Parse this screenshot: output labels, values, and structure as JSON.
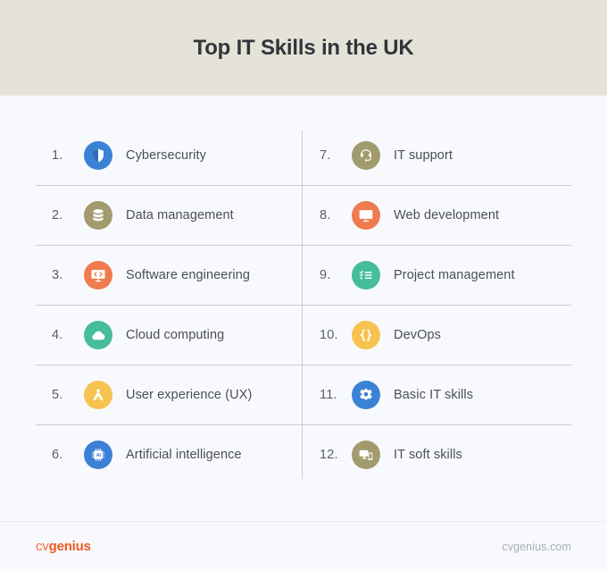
{
  "header": {
    "title": "Top IT Skills in the UK",
    "background_color": "#e5e2d8",
    "title_color": "#31343a"
  },
  "page": {
    "background_color": "#f8f9fc",
    "divider_color": "#c9cbd4",
    "label_color": "#4a4f58"
  },
  "skills": {
    "left_column": [
      {
        "rank": "1.",
        "label": "Cybersecurity",
        "icon": "shield-icon",
        "color": "#3b82d6"
      },
      {
        "rank": "2.",
        "label": "Data management",
        "icon": "database-icon",
        "color": "#a19b6e"
      },
      {
        "rank": "3.",
        "label": "Software engineering",
        "icon": "code-monitor-icon",
        "color": "#ef7b4e"
      },
      {
        "rank": "4.",
        "label": "Cloud computing",
        "icon": "cloud-icon",
        "color": "#45bd9a"
      },
      {
        "rank": "5.",
        "label": "User experience (UX)",
        "icon": "compass-icon",
        "color": "#f7c350"
      },
      {
        "rank": "6.",
        "label": "Artificial intelligence",
        "icon": "ai-chip-icon",
        "color": "#3b82d6"
      }
    ],
    "right_column": [
      {
        "rank": "7.",
        "label": "IT support",
        "icon": "headset-icon",
        "color": "#a19b6e"
      },
      {
        "rank": "8.",
        "label": "Web development",
        "icon": "monitor-icon",
        "color": "#ef7b4e"
      },
      {
        "rank": "9.",
        "label": "Project management",
        "icon": "checklist-icon",
        "color": "#45bd9a"
      },
      {
        "rank": "10.",
        "label": "DevOps",
        "icon": "braces-icon",
        "color": "#f7c350"
      },
      {
        "rank": "11.",
        "label": "Basic IT skills",
        "icon": "gear-icon",
        "color": "#3b82d6"
      },
      {
        "rank": "12.",
        "label": "IT soft skills",
        "icon": "devices-icon",
        "color": "#a19b6e"
      }
    ]
  },
  "footer": {
    "logo_part1": "cv",
    "logo_part2": "genius",
    "logo_color": "#ef5a20",
    "url": "cvgenius.com"
  }
}
